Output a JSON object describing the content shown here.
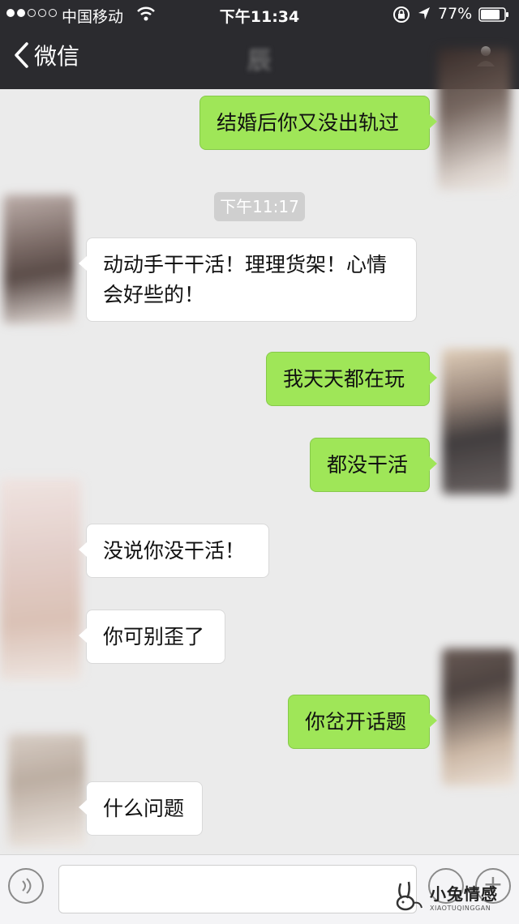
{
  "status": {
    "carrier": "中国移动",
    "time": "下午11:34",
    "battery": "77%"
  },
  "nav": {
    "back_label": "微信",
    "title": "辰"
  },
  "timestamp": "下午11:17",
  "messages": [
    {
      "side": "right",
      "text": "结婚后你又没出轨过"
    },
    {
      "side": "left",
      "text": "动动手干干活！理理货架！心情会好些的！"
    },
    {
      "side": "right",
      "text": "我天天都在玩"
    },
    {
      "side": "right",
      "text": "都没干活"
    },
    {
      "side": "left",
      "text": "没说你没干活！"
    },
    {
      "side": "left",
      "text": "你可别歪了"
    },
    {
      "side": "right",
      "text": "你岔开话题"
    },
    {
      "side": "left",
      "text": "什么问题"
    }
  ],
  "watermark": {
    "name": "小兔情感",
    "url": "XIAOTUQINGGAN"
  },
  "colors": {
    "bar": "#2b2b2f",
    "bubble_out": "#9fe658",
    "bubble_in": "#ffffff",
    "chat_bg": "#ebebeb"
  }
}
